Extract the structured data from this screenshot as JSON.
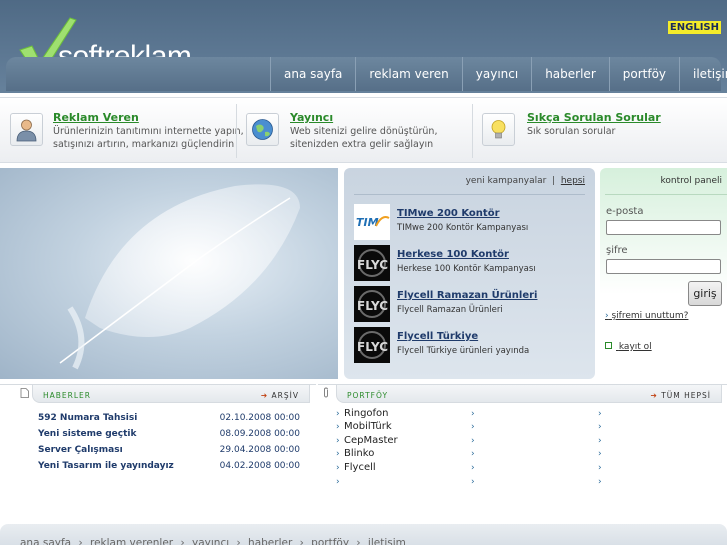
{
  "header": {
    "logo_text": "softreklam",
    "language": "ENGLISH",
    "nav": [
      "ana sayfa",
      "reklam veren",
      "yayıncı",
      "haberler",
      "portföy",
      "iletişim"
    ]
  },
  "info": [
    {
      "title": "Reklam Veren",
      "desc1": "Ürünlerinizin tanıtımını internette yapın,",
      "desc2": "satışınızı artırın, markanızı güçlendirin",
      "icon": "advertiser-user-icon"
    },
    {
      "title": "Yayıncı",
      "desc1": "Web sitenizi gelire dönüştürün,",
      "desc2": "sitenizden extra gelir sağlayın",
      "icon": "globe-icon"
    },
    {
      "title": "Sıkça Sorulan Sorular",
      "desc1": "Sık sorulan sorular",
      "desc2": "",
      "icon": "lightbulb-icon"
    }
  ],
  "campaigns": {
    "header_label": "yeni kampanyalar",
    "all_link": "hepsi",
    "items": [
      {
        "title": "TIMwe 200 Kontör",
        "subtitle": "TIMwe 200 Kontör Kampanyası",
        "logo": "TIMwe"
      },
      {
        "title": "Herkese 100 Kontör",
        "subtitle": "Herkese 100 Kontör Kampanyası",
        "logo": "FLYC"
      },
      {
        "title": "Flycell Ramazan Ürünleri",
        "subtitle": "Flycell Ramazan Ürünleri",
        "logo": "FLYC"
      },
      {
        "title": "Flycell Türkiye",
        "subtitle": "Flycell Türkiye ürünleri yayında",
        "logo": "FLYC"
      }
    ]
  },
  "login": {
    "title": "kontrol paneli",
    "email_label": "e-posta",
    "password_label": "şifre",
    "submit": "giriş",
    "forgot": "şifremi unuttum?",
    "register": "kayıt ol"
  },
  "news": {
    "title": "HABERLER",
    "archive": "ARŞİV",
    "items": [
      {
        "title": "592 Numara Tahsisi",
        "date": "02.10.2008 00:00"
      },
      {
        "title": "Yeni sisteme geçtik",
        "date": "08.09.2008 00:00"
      },
      {
        "title": "Server Çalışması",
        "date": "29.04.2008 00:00"
      },
      {
        "title": "Yeni Tasarım ile yayındayız",
        "date": "04.02.2008 00:00"
      }
    ]
  },
  "portfolio": {
    "title": "PORTFÖY",
    "all": "TÜM HEPSİ",
    "items": [
      "Ringofon",
      "MobilTürk",
      "CepMaster",
      "Blinko",
      "Flycell",
      ""
    ]
  },
  "footer": {
    "links": [
      "ana sayfa",
      "reklam verenler",
      "yayıncı",
      "haberler",
      "portföy",
      "iletişim"
    ]
  }
}
